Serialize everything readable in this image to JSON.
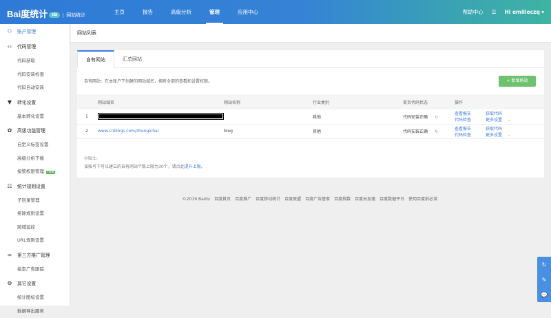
{
  "header": {
    "logo": "Bai度统计",
    "logo_badge": "tiB",
    "product": "网站统计",
    "nav": [
      "主页",
      "报告",
      "高级分析",
      "管理",
      "应用中心"
    ],
    "active_nav": 3,
    "help": "帮助中心",
    "user": "Hi  emilieczq"
  },
  "sidebar": [
    {
      "label": "账户管理",
      "icon": "user-icon",
      "active": true,
      "children": []
    },
    {
      "label": "代码管理",
      "icon": "code-icon",
      "children": [
        "代码获取",
        "代码安装检查",
        "代码自动安装"
      ]
    },
    {
      "label": "转化设置",
      "icon": "filter-icon",
      "children": [
        "基本转化设置"
      ]
    },
    {
      "label": "高级功能管理",
      "icon": "advanced-icon",
      "children": [
        "自定义标签设置",
        "高级分析下载",
        "指警权限管理"
      ]
    },
    {
      "label": "统计规则设置",
      "icon": "sliders-icon",
      "children": [
        "子目录管理",
        "排除规则设置",
        "跨域监控",
        "URL规则设置"
      ]
    },
    {
      "label": "第三方推广管理",
      "icon": "link-icon",
      "children": [
        "指定广告跟踪"
      ]
    },
    {
      "label": "其它设置",
      "icon": "gear-icon",
      "children": [
        "统计图标设置",
        "数据导出服务"
      ]
    }
  ],
  "new_badge": "new",
  "breadcrumb": "网站列表",
  "tabs": [
    "自有网站",
    "汇总网站"
  ],
  "description": "自有网站：在本账户下创建的网站域名，拥有全部的查看和设置权限。",
  "add_button": "+ 新增网站",
  "table": {
    "headers": [
      "",
      "网站域名",
      "网站名称",
      "行业类别",
      "首页代码状态",
      "操作"
    ],
    "rows": [
      {
        "index": "1",
        "domain": "",
        "name": "",
        "industry": "其他",
        "status": "代码安装正确"
      },
      {
        "index": "2",
        "domain": "www.cnblogs.com/zhengichai",
        "name": "blog",
        "industry": "其他",
        "status": "代码安装正确"
      }
    ],
    "actions": [
      "查看报告",
      "获取代码",
      "代码检查",
      "更多设置"
    ]
  },
  "tips": {
    "title": "小贴士:",
    "text": "该账号下可以建立的自有网站个数上限为30个，请点此",
    "link": "提升上限",
    "end": "。"
  },
  "footer": [
    "©2019 Baidu",
    "百度首页",
    "百度推广",
    "百度移动统计",
    "百度联盟",
    "百度广告管家",
    "百度指数",
    "百度云加速",
    "百度数据平台",
    "使用百度前必读"
  ]
}
